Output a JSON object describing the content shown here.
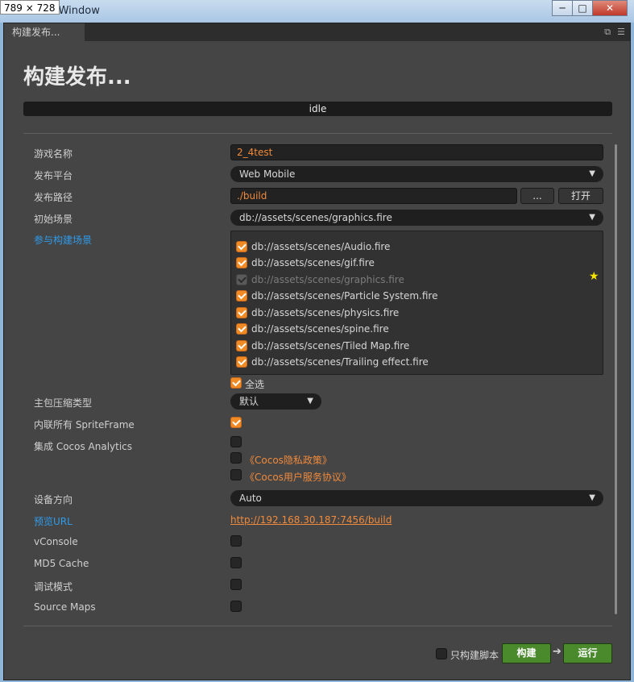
{
  "window": {
    "size_label": "789 × 728",
    "title": "Editor Window",
    "tab": "构建发布...",
    "controls": {
      "minimize": "─",
      "maximize": "□",
      "close": "✕"
    }
  },
  "heading": "构建发布...",
  "status": "idle",
  "fields": {
    "game_name": {
      "label": "游戏名称",
      "value": "2_4test"
    },
    "platform": {
      "label": "发布平台",
      "value": "Web Mobile"
    },
    "build_path": {
      "label": "发布路径",
      "value": "./build",
      "browse": "...",
      "open": "打开"
    },
    "start_scene": {
      "label": "初始场景",
      "value": "db://assets/scenes/graphics.fire"
    },
    "scenes": {
      "label": "参与构建场景",
      "items": [
        {
          "path": "db://assets/scenes/Audio.fire",
          "checked": true
        },
        {
          "path": "db://assets/scenes/gif.fire",
          "checked": true
        },
        {
          "path": "db://assets/scenes/graphics.fire",
          "checked": true,
          "disabled": true
        },
        {
          "path": "db://assets/scenes/Particle System.fire",
          "checked": true
        },
        {
          "path": "db://assets/scenes/physics.fire",
          "checked": true
        },
        {
          "path": "db://assets/scenes/spine.fire",
          "checked": true
        },
        {
          "path": "db://assets/scenes/Tiled Map.fire",
          "checked": true
        },
        {
          "path": "db://assets/scenes/Trailing effect.fire",
          "checked": true
        }
      ],
      "select_all": "全选",
      "star_icon": "star-icon"
    },
    "compression": {
      "label": "主包压缩类型",
      "value": "默认"
    },
    "inline_spriteframe": {
      "label": "内联所有 SpriteFrame",
      "checked": true
    },
    "analytics": {
      "label": "集成 Cocos Analytics",
      "checked": false,
      "privacy": "《Cocos隐私政策》",
      "service": "《Cocos用户服务协议》"
    },
    "orientation": {
      "label": "设备方向",
      "value": "Auto"
    },
    "preview_url": {
      "label": "预览URL",
      "value": "http://192.168.30.187:7456/build"
    },
    "vconsole": {
      "label": "vConsole"
    },
    "md5": {
      "label": "MD5 Cache"
    },
    "debug": {
      "label": "调试模式"
    },
    "source_maps": {
      "label": "Source Maps"
    }
  },
  "footer": {
    "build_scripts_only": "只构建脚本",
    "build": "构建",
    "arrow": "➔",
    "run": "运行"
  },
  "colors": {
    "accent_orange": "#f08a3c",
    "link_blue": "#2f9bea",
    "button_green": "#4a8a2d"
  }
}
